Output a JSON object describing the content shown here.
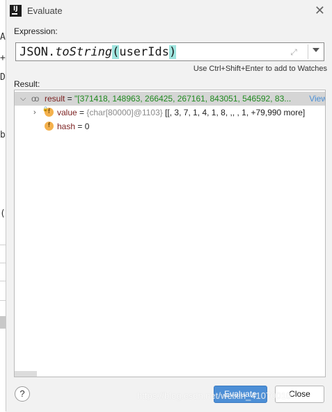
{
  "window": {
    "title": "Evaluate"
  },
  "expression": {
    "label": "Expression:",
    "part1": "JSON.",
    "part2": "toString",
    "part3": "(",
    "part4": "userIds",
    "part5": ")",
    "hint": "Use Ctrl+Shift+Enter to add to Watches"
  },
  "result": {
    "label": "Result:",
    "rows": [
      {
        "name": "result",
        "eq": " = ",
        "value": "\"[371418, 148963, 266425, 267161, 843051, 546592, 83...",
        "link": "View"
      },
      {
        "name": "value",
        "eq": " = ",
        "type": "{char[80000]@1103}",
        "value": " [[, 3, 7, 1, 4, 1, 8, ,,  , 1, +79,990 more]"
      },
      {
        "name": "hash",
        "eq": " = ",
        "value": "0"
      }
    ]
  },
  "buttons": {
    "help": "?",
    "evaluate": "Evaluate",
    "close": "Close"
  },
  "watermark": "https://blog.csdn.net/weixin_41070010",
  "background_glyphs": [
    "A",
    "+",
    "D",
    "b",
    "("
  ],
  "colors": {
    "accent": "#4d8fd6",
    "highlight": "#9fe5df",
    "string": "#1f8a1f",
    "field_badge": "#f4b14d"
  }
}
